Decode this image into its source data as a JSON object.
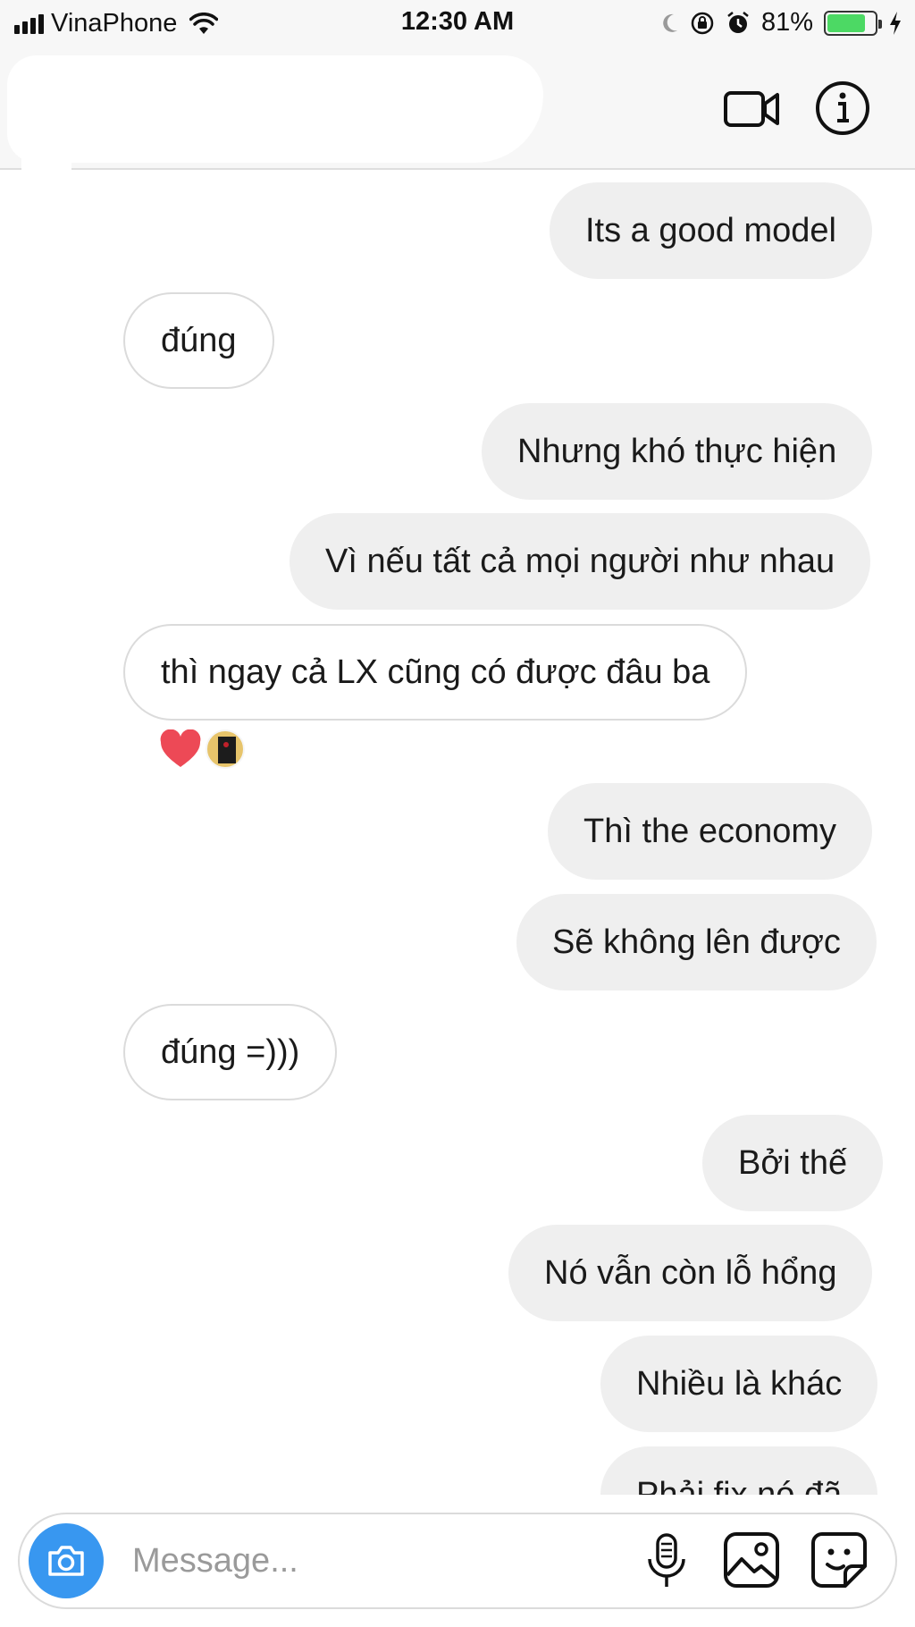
{
  "status_bar": {
    "carrier": "VinaPhone",
    "time": "12:30 AM",
    "battery_percent": "81%",
    "battery_level": 0.81,
    "icons": [
      "signal-icon",
      "wifi-icon",
      "moon-icon",
      "orientation-lock-icon",
      "alarm-icon",
      "battery-icon",
      "charging-icon"
    ]
  },
  "header": {
    "icons": [
      "video-call-icon",
      "info-icon"
    ]
  },
  "messages": [
    {
      "direction": "out",
      "text": "Its a good model"
    },
    {
      "direction": "in",
      "text": "đúng"
    },
    {
      "direction": "out",
      "text": "Nhưng khó thực hiện"
    },
    {
      "direction": "out",
      "text": "Vì nếu tất cả mọi người như nhau"
    },
    {
      "direction": "in",
      "text": "thì ngay cả LX cũng có được đâu ba"
    },
    {
      "direction": "out",
      "text": "Thì the economy"
    },
    {
      "direction": "out",
      "text": "Sẽ không lên được"
    },
    {
      "direction": "in",
      "text": "đúng =)))"
    },
    {
      "direction": "out",
      "text": "Bởi thế"
    },
    {
      "direction": "out",
      "text": "Nó vẫn còn lỗ hổng"
    },
    {
      "direction": "out",
      "text": "Nhiều là khác"
    },
    {
      "direction": "out",
      "text": "Phải fix nó đã"
    }
  ],
  "reaction": {
    "emoji": "heart-icon",
    "color": "#ed4956"
  },
  "composer": {
    "placeholder": "Message...",
    "accent": "#3897f0",
    "icons": [
      "camera-icon",
      "microphone-icon",
      "gallery-icon",
      "sticker-icon"
    ]
  }
}
